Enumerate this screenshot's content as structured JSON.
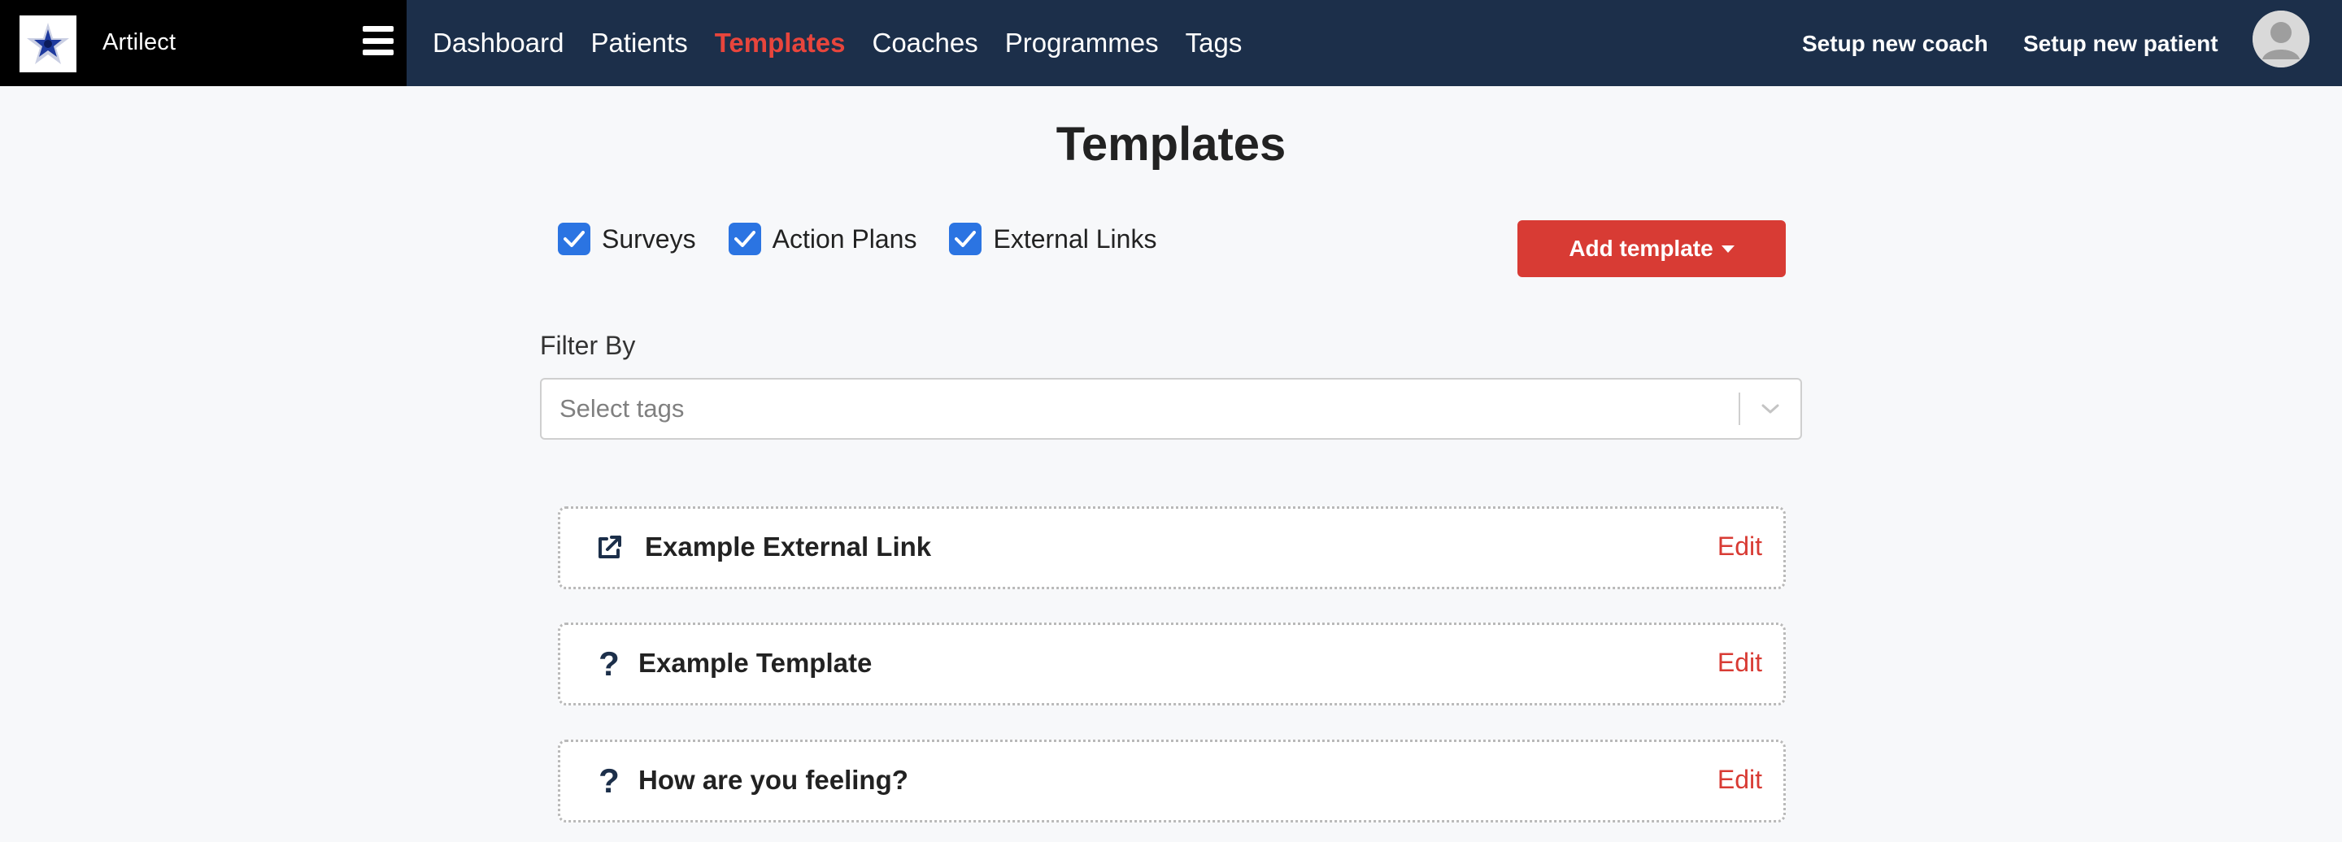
{
  "app": {
    "name": "Artilect"
  },
  "nav": {
    "items": [
      {
        "label": "Dashboard"
      },
      {
        "label": "Patients"
      },
      {
        "label": "Templates",
        "active": true
      },
      {
        "label": "Coaches"
      },
      {
        "label": "Programmes"
      },
      {
        "label": "Tags"
      }
    ]
  },
  "header_actions": {
    "setup_coach": "Setup new coach",
    "setup_patient": "Setup new patient"
  },
  "page": {
    "title": "Templates"
  },
  "filters": {
    "checkboxes": [
      {
        "label": "Surveys",
        "checked": true
      },
      {
        "label": "Action Plans",
        "checked": true
      },
      {
        "label": "External Links",
        "checked": true
      }
    ],
    "add_template_label": "Add template",
    "filter_by_label": "Filter By",
    "tags_placeholder": "Select tags"
  },
  "templates": [
    {
      "title": "Example External Link",
      "icon": "external-link-icon",
      "edit_label": "Edit"
    },
    {
      "title": "Example Template",
      "icon": "question-icon",
      "edit_label": "Edit"
    },
    {
      "title": "How are you feeling?",
      "icon": "question-icon",
      "edit_label": "Edit"
    }
  ],
  "colors": {
    "navbar": "#1c2f4a",
    "brand_bg": "#000000",
    "accent_red": "#d83b34",
    "active_nav": "#e8453c",
    "checkbox": "#2b74e2",
    "page_bg": "#f7f8fa"
  }
}
